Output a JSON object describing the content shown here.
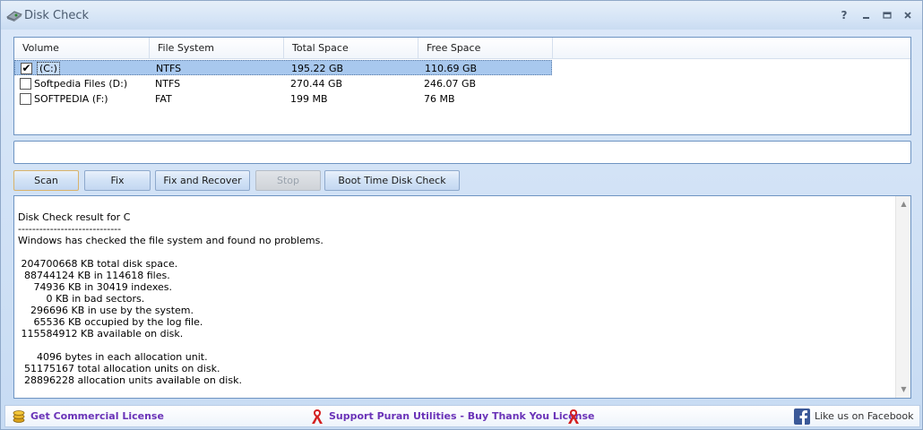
{
  "window": {
    "title": "Disk Check",
    "buttons": {
      "help": "?",
      "minimize": "_",
      "maximize": "□",
      "close": "✕"
    }
  },
  "volumes": {
    "columns": [
      "Volume",
      "File System",
      "Total Space",
      "Free Space"
    ],
    "rows": [
      {
        "checked": true,
        "volume": "(C:)",
        "fs": "NTFS",
        "total": "195.22 GB",
        "free": "110.69 GB",
        "selected": true
      },
      {
        "checked": false,
        "volume": "Softpedia Files (D:)",
        "fs": "NTFS",
        "total": "270.44 GB",
        "free": "246.07 GB",
        "selected": false
      },
      {
        "checked": false,
        "volume": "SOFTPEDIA (F:)",
        "fs": "FAT",
        "total": "199 MB",
        "free": "76 MB",
        "selected": false
      }
    ]
  },
  "status_field": {
    "value": ""
  },
  "actions": {
    "scan": "Scan",
    "fix": "Fix",
    "fix_recover": "Fix and Recover",
    "stop": "Stop",
    "boot_check": "Boot Time Disk Check"
  },
  "result": {
    "text": "Disk Check result for C\n-----------------------------\nWindows has checked the file system and found no problems.\n\n 204700668 KB total disk space.\n  88744124 KB in 114618 files.\n     74936 KB in 30419 indexes.\n         0 KB in bad sectors.\n    296696 KB in use by the system.\n     65536 KB occupied by the log file.\n 115584912 KB available on disk.\n\n      4096 bytes in each allocation unit.\n  51175167 total allocation units on disk.\n  28896228 allocation units available on disk."
  },
  "footer": {
    "license": "Get Commercial License",
    "support": "Support Puran Utilities - Buy Thank You License",
    "facebook": "Like us on Facebook"
  },
  "colors": {
    "link_purple": "#6a33b8",
    "ribbon_red": "#d42020",
    "facebook_blue": "#3b5998",
    "selection_blue": "#a8c8ee"
  }
}
